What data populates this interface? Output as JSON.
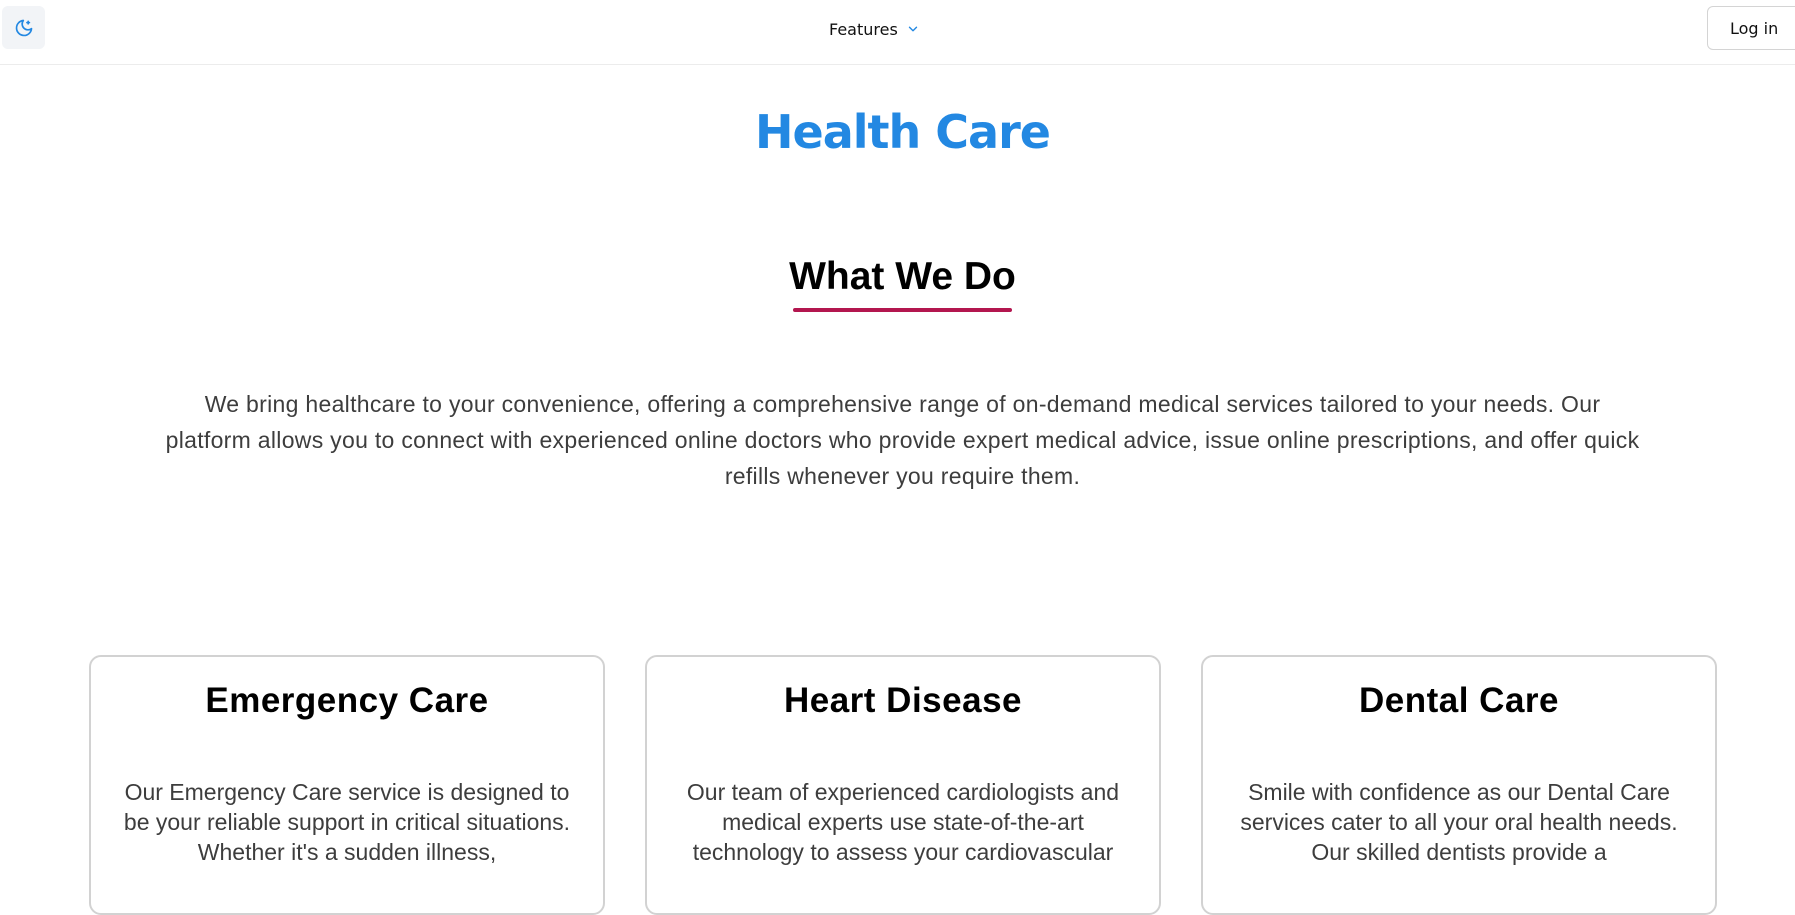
{
  "header": {
    "theme_toggle_icon": "moon-icon",
    "features_label": "Features",
    "features_chevron_icon": "chevron-down-icon",
    "login_label": "Log in"
  },
  "brand": {
    "title": "Health Care",
    "color": "#2388e2"
  },
  "what_we_do": {
    "title": "What We Do",
    "underline_color": "#b3164f",
    "description": "We bring healthcare to your convenience, offering a comprehensive range of on-demand medical services tailored to your needs. Our platform allows you to connect with experienced online doctors who provide expert medical advice, issue online prescriptions, and offer quick refills whenever you require them."
  },
  "services": [
    {
      "title": "Emergency Care",
      "description": "Our Emergency Care service is designed to be your reliable support in critical situations. Whether it's a sudden illness,"
    },
    {
      "title": "Heart Disease",
      "description": "Our team of experienced cardiologists and medical experts use state-of-the-art technology to assess your cardiovascular"
    },
    {
      "title": "Dental Care",
      "description": "Smile with confidence as our Dental Care services cater to all your oral health needs. Our skilled dentists provide a"
    }
  ]
}
